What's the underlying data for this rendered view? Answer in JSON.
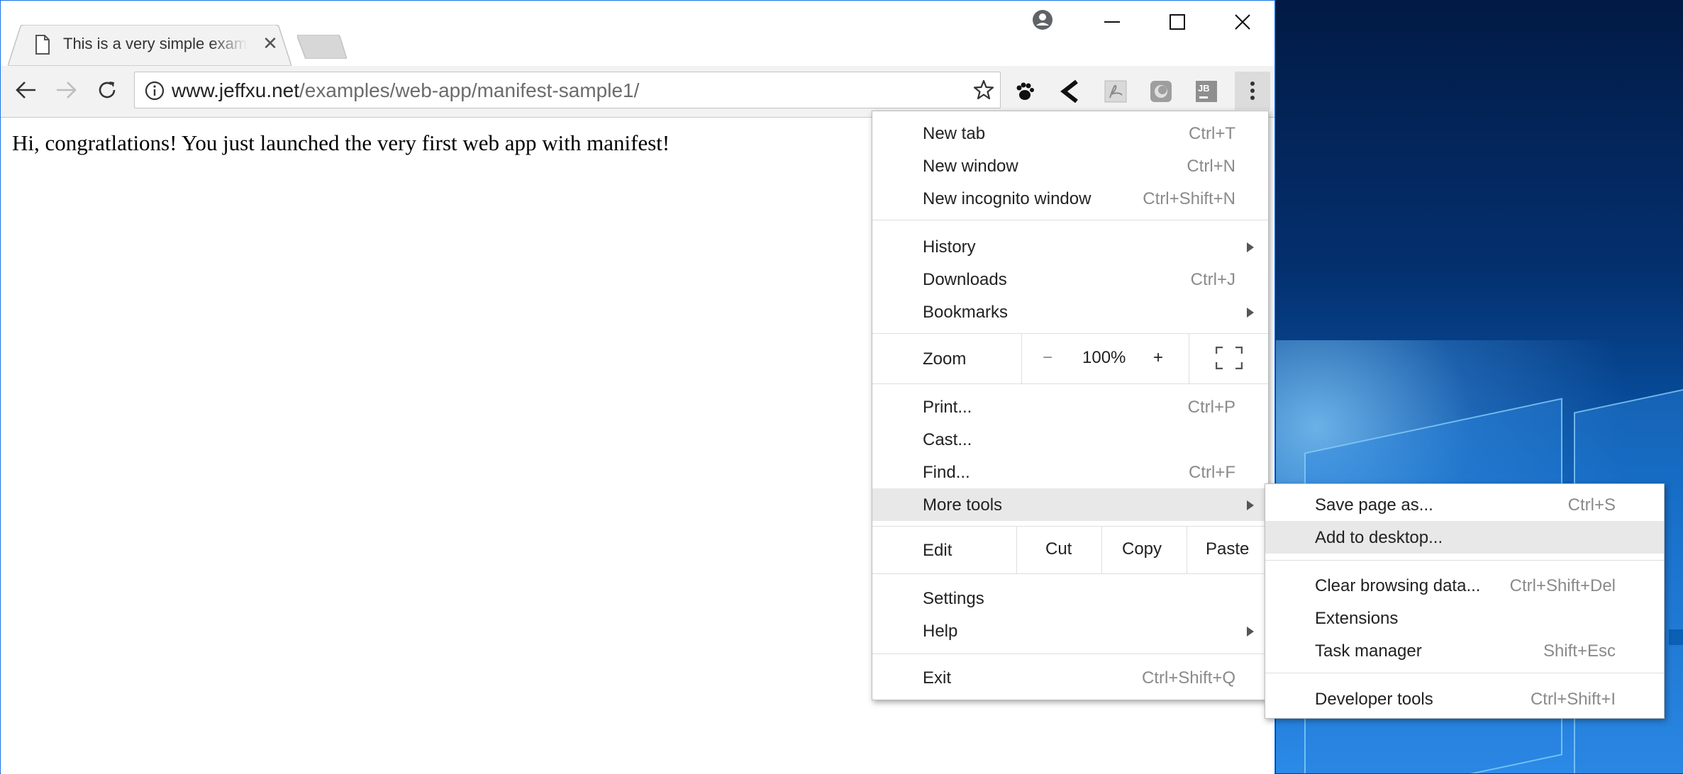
{
  "browser": {
    "tab_title": "This is a very simple example",
    "url_host": "www.jeffxu.net",
    "url_path": "/examples/web-app/manifest-sample1/"
  },
  "page": {
    "body_text": "Hi, congratlations! You just launched the very first web app with manifest!"
  },
  "main_menu": {
    "new_tab": {
      "label": "New tab",
      "shortcut": "Ctrl+T"
    },
    "new_window": {
      "label": "New window",
      "shortcut": "Ctrl+N"
    },
    "new_incognito": {
      "label": "New incognito window",
      "shortcut": "Ctrl+Shift+N"
    },
    "history": {
      "label": "History"
    },
    "downloads": {
      "label": "Downloads",
      "shortcut": "Ctrl+J"
    },
    "bookmarks": {
      "label": "Bookmarks"
    },
    "zoom": {
      "label": "Zoom",
      "minus": "−",
      "value": "100%",
      "plus": "+"
    },
    "print": {
      "label": "Print...",
      "shortcut": "Ctrl+P"
    },
    "cast": {
      "label": "Cast..."
    },
    "find": {
      "label": "Find...",
      "shortcut": "Ctrl+F"
    },
    "more_tools": {
      "label": "More tools"
    },
    "edit": {
      "label": "Edit",
      "cut": "Cut",
      "copy": "Copy",
      "paste": "Paste"
    },
    "settings": {
      "label": "Settings"
    },
    "help": {
      "label": "Help"
    },
    "exit": {
      "label": "Exit",
      "shortcut": "Ctrl+Shift+Q"
    }
  },
  "more_tools_menu": {
    "save_page": {
      "label": "Save page as...",
      "shortcut": "Ctrl+S"
    },
    "add_desktop": {
      "label": "Add to desktop..."
    },
    "clear_browsing": {
      "label": "Clear browsing data...",
      "shortcut": "Ctrl+Shift+Del"
    },
    "extensions": {
      "label": "Extensions"
    },
    "task_manager": {
      "label": "Task manager",
      "shortcut": "Shift+Esc"
    },
    "developer_tools": {
      "label": "Developer tools",
      "shortcut": "Ctrl+Shift+I"
    }
  },
  "extensions": {
    "ext_1": "JB"
  },
  "colors": {
    "menu_highlight": "#e8e8e8",
    "window_border": "#1a73e8",
    "desktop_blue": "#0a5fb8"
  }
}
